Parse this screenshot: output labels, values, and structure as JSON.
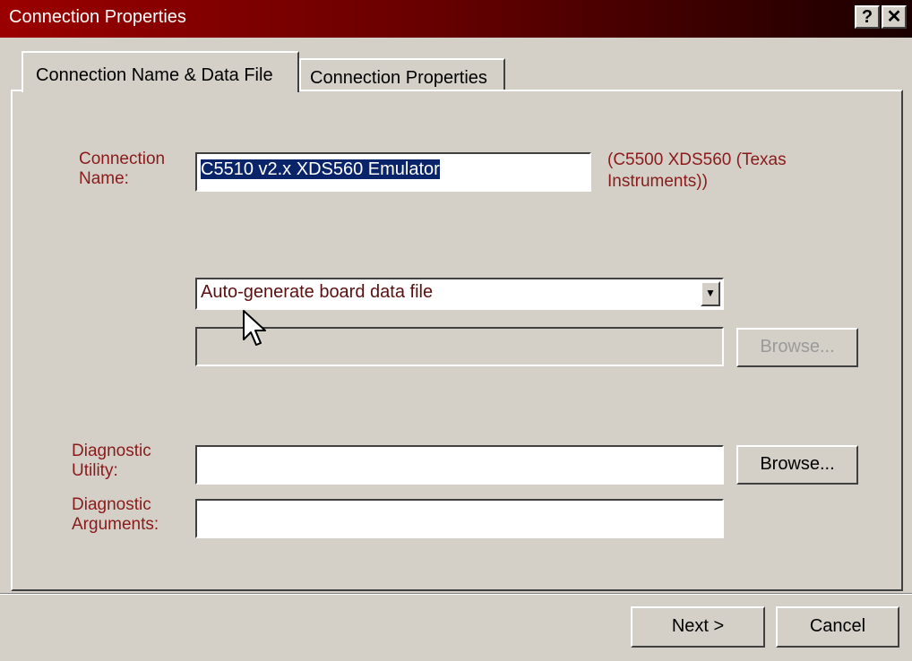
{
  "window": {
    "title": "Connection Properties",
    "help_button": "?",
    "close_button": "✕"
  },
  "tabs": [
    {
      "label": "Connection Name & Data File",
      "active": true
    },
    {
      "label": "Connection Properties",
      "active": false
    }
  ],
  "connection_name": {
    "label": "Connection Name:",
    "value": "C5510 v2.x XDS560 Emulator",
    "hint": "(C5500 XDS560 (Texas Instruments))"
  },
  "board_data": {
    "selected_option": "Auto-generate board data file",
    "file_path_value": "",
    "browse_label": "Browse...",
    "browse_enabled": false
  },
  "diagnostic_utility": {
    "label": "Diagnostic Utility:",
    "value": "",
    "browse_label": "Browse..."
  },
  "diagnostic_arguments": {
    "label": "Diagnostic Arguments:",
    "value": ""
  },
  "footer": {
    "next_label": "Next >",
    "cancel_label": "Cancel"
  },
  "colors": {
    "title_gradient_start": "#9b0000",
    "title_gradient_end": "#1a0000",
    "label_color": "#8b1a1a",
    "face": "#d4d0c8",
    "selection": "#0a246a"
  }
}
